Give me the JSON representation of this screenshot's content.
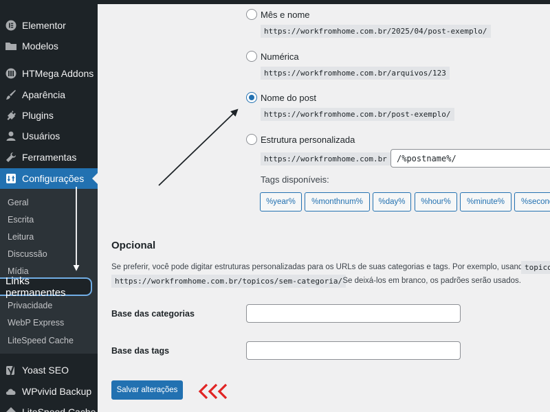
{
  "sidebar": {
    "items": [
      {
        "label": "Elementor",
        "icon": "elementor-icon"
      },
      {
        "label": "Modelos",
        "icon": "folder-icon"
      },
      {
        "label": "HTMega Addons",
        "icon": "htmega-icon"
      },
      {
        "label": "Aparência",
        "icon": "brush-icon"
      },
      {
        "label": "Plugins",
        "icon": "plug-icon"
      },
      {
        "label": "Usuários",
        "icon": "user-icon"
      },
      {
        "label": "Ferramentas",
        "icon": "wrench-icon"
      },
      {
        "label": "Configurações",
        "icon": "settings-icon"
      },
      {
        "label": "Yoast SEO",
        "icon": "yoast-icon"
      },
      {
        "label": "WPvivid Backup",
        "icon": "cloud-icon"
      },
      {
        "label": "LiteSpeed Cache",
        "icon": "litespeed-icon"
      }
    ],
    "submenu": [
      {
        "label": "Geral"
      },
      {
        "label": "Escrita"
      },
      {
        "label": "Leitura"
      },
      {
        "label": "Discussão"
      },
      {
        "label": "Mídia"
      },
      {
        "label": "Links permanentes"
      },
      {
        "label": "Privacidade"
      },
      {
        "label": "WebP Express"
      },
      {
        "label": "LiteSpeed Cache"
      }
    ]
  },
  "permalink_options": [
    {
      "label": "Mês e nome",
      "example": "https://workfromhome.com.br/2025/04/post-exemplo/",
      "checked": false
    },
    {
      "label": "Numérica",
      "example": "https://workfromhome.com.br/arquivos/123",
      "checked": false
    },
    {
      "label": "Nome do post",
      "example": "https://workfromhome.com.br/post-exemplo/",
      "checked": true
    },
    {
      "label": "Estrutura personalizada",
      "example": "https://workfromhome.com.br",
      "checked": false
    }
  ],
  "custom_structure_value": "/%postname%/",
  "tags_label": "Tags disponíveis:",
  "tags": [
    "%year%",
    "%monthnum%",
    "%day%",
    "%hour%",
    "%minute%",
    "%second%"
  ],
  "optional": {
    "title": "Opcional",
    "desc_line1": "Se preferir, você pode digitar estruturas personalizadas para os URLs de suas categorias e tags. Por exemplo, usando",
    "desc_code1": "topicos",
    "desc_code2": "https://workfromhome.com.br/topicos/sem-categoria/",
    "desc_line2": ". Se deixá-los em branco, os padrões serão usados.",
    "category_base_label": "Base das categorias",
    "category_base_value": "",
    "tag_base_label": "Base das tags",
    "tag_base_value": ""
  },
  "save_button": "Salvar alterações",
  "colors": {
    "accent": "#2271b1",
    "annotation": "#e02424"
  }
}
